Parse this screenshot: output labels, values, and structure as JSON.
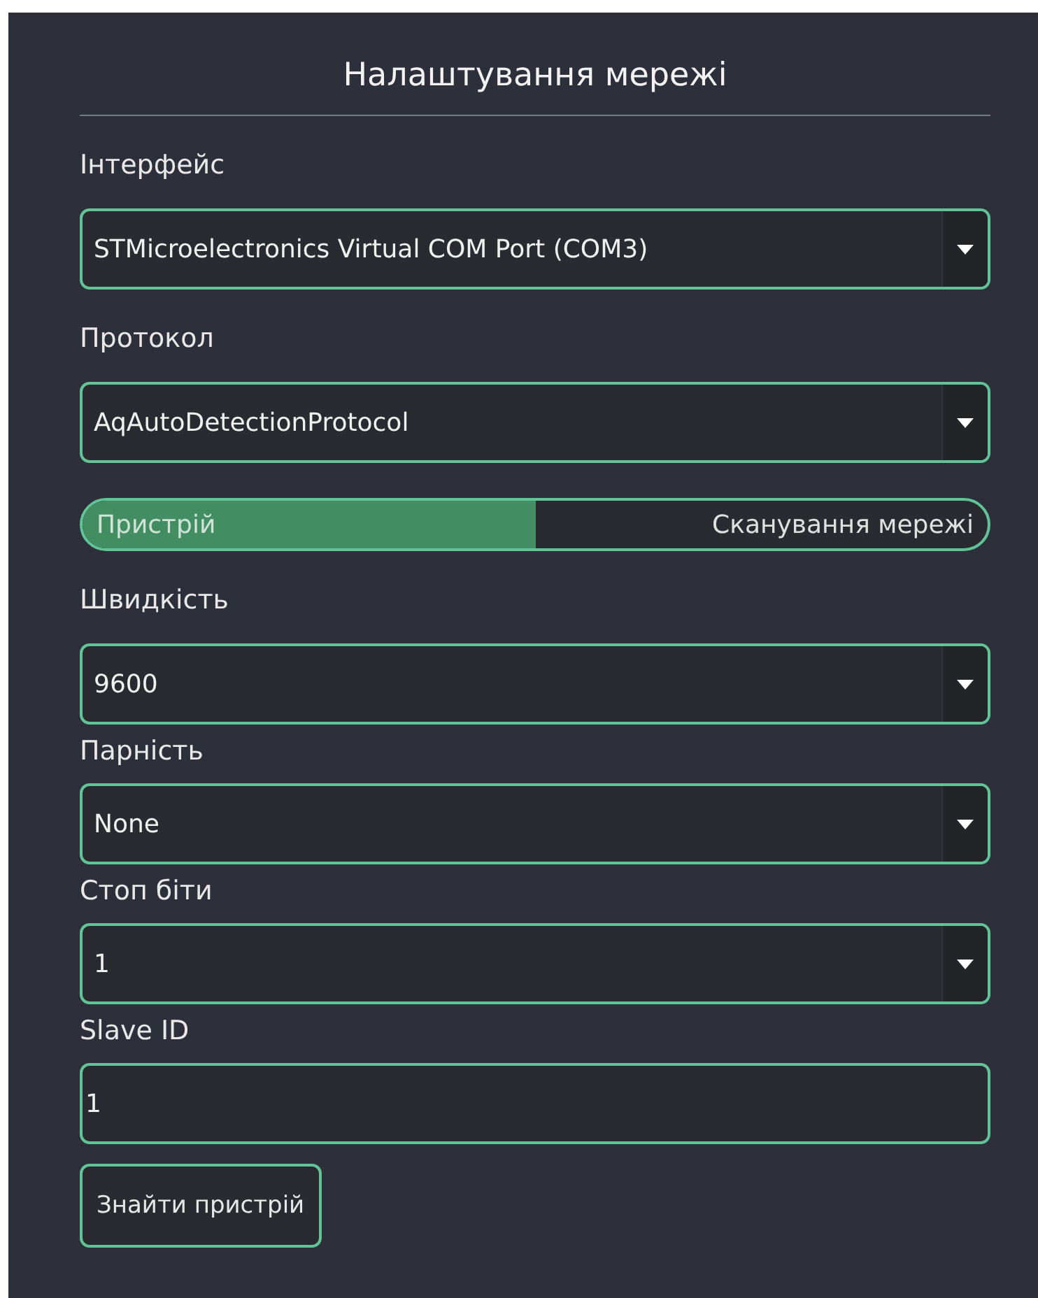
{
  "title": "Налаштування мережі",
  "connection_fields": [
    {
      "label": "Інтерфейс",
      "kind": "combo",
      "value": "STMicroelectronics Virtual COM Port (COM3)"
    },
    {
      "label": "Протокол",
      "kind": "combo",
      "value": "AqAutoDetectionProtocol"
    }
  ],
  "mode_toggle": [
    {
      "label": "Пристрій",
      "selected": true
    },
    {
      "label": "Сканування мережі",
      "selected": false
    }
  ],
  "device_fields": [
    {
      "label": "Швидкість",
      "kind": "combo",
      "value": "9600"
    },
    {
      "label": "Парність",
      "kind": "combo",
      "value": "None"
    },
    {
      "label": "Стоп біти",
      "kind": "combo",
      "value": "1"
    },
    {
      "label": "Slave ID",
      "kind": "input",
      "value": "1"
    }
  ],
  "button": "Знайти пристрій"
}
